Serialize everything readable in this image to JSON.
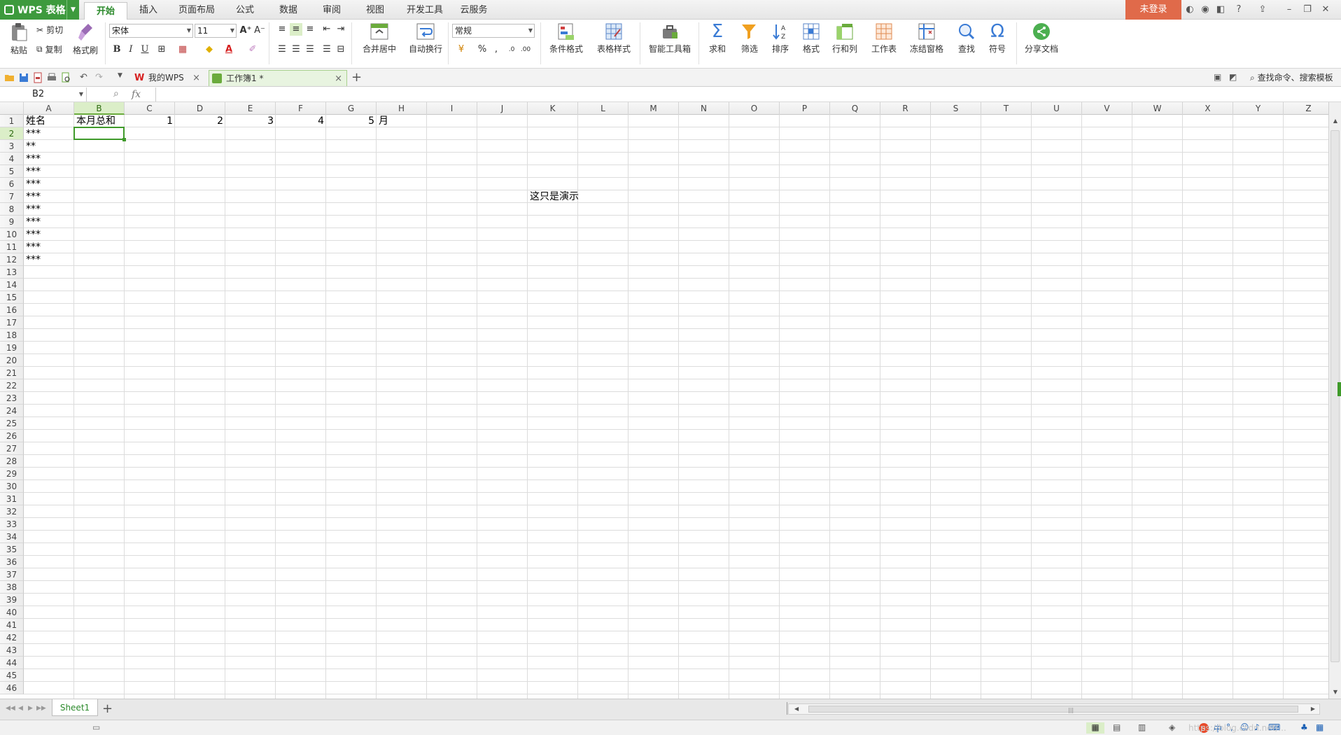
{
  "app": {
    "name": "WPS 表格",
    "login_label": "未登录"
  },
  "menu": {
    "tabs": [
      {
        "label": "开始",
        "active": true
      },
      {
        "label": "插入"
      },
      {
        "label": "页面布局"
      },
      {
        "label": "公式"
      },
      {
        "label": "数据"
      },
      {
        "label": "审阅"
      },
      {
        "label": "视图"
      },
      {
        "label": "开发工具"
      },
      {
        "label": "云服务"
      }
    ]
  },
  "ribbon": {
    "paste": "粘贴",
    "cut": "剪切",
    "copy": "复制",
    "format_painter": "格式刷",
    "font_name": "宋体",
    "font_size": "11",
    "merge_center": "合并居中",
    "wrap_text": "自动换行",
    "number_format": "常规",
    "percent": "%",
    "comma": ",",
    "conditional_format": "条件格式",
    "table_style": "表格样式",
    "smart_toolbox": "智能工具箱",
    "sum": "求和",
    "filter": "筛选",
    "sort": "排序",
    "format": "格式",
    "rows_cols": "行和列",
    "worksheet": "工作表",
    "freeze": "冻结窗格",
    "find": "查找",
    "symbol": "符号",
    "share": "分享文档",
    "bold": "B",
    "italic": "I",
    "underline": "U"
  },
  "doc_tabs": [
    {
      "label": "我的WPS",
      "active": false
    },
    {
      "label": "工作簿1 *",
      "active": true
    }
  ],
  "search_cmd": "查找命令、搜索模板",
  "formula_bar": {
    "name_box": "B2",
    "fx": "fx",
    "content": ""
  },
  "grid": {
    "columns": [
      "A",
      "B",
      "C",
      "D",
      "E",
      "F",
      "G",
      "H",
      "I",
      "J",
      "K",
      "L",
      "M",
      "N",
      "O",
      "P",
      "Q",
      "R",
      "S",
      "T",
      "U",
      "V",
      "W",
      "X",
      "Y",
      "Z"
    ],
    "rows": [
      "1",
      "2",
      "3",
      "4",
      "5",
      "6",
      "7",
      "8",
      "9",
      "10",
      "11",
      "12",
      "13",
      "14",
      "15",
      "16",
      "17",
      "18",
      "19",
      "20",
      "21",
      "22",
      "23",
      "24",
      "25",
      "26",
      "27",
      "28",
      "29",
      "30",
      "31",
      "32",
      "33",
      "34",
      "35",
      "36",
      "37",
      "38",
      "39",
      "40",
      "41",
      "42",
      "43",
      "44",
      "45",
      "46"
    ],
    "selected_cell": "B2",
    "cells": [
      {
        "ref": "A1",
        "text": "姓名"
      },
      {
        "ref": "B1",
        "text": "本月总和"
      },
      {
        "ref": "C1",
        "text": "1",
        "num": true
      },
      {
        "ref": "D1",
        "text": "2",
        "num": true
      },
      {
        "ref": "E1",
        "text": "3",
        "num": true
      },
      {
        "ref": "F1",
        "text": "4",
        "num": true
      },
      {
        "ref": "G1",
        "text": "5",
        "num": true
      },
      {
        "ref": "H1",
        "text": "月"
      },
      {
        "ref": "A2",
        "text": "***"
      },
      {
        "ref": "A3",
        "text": "**"
      },
      {
        "ref": "A4",
        "text": "***"
      },
      {
        "ref": "A5",
        "text": "***"
      },
      {
        "ref": "A6",
        "text": "***"
      },
      {
        "ref": "A7",
        "text": "***"
      },
      {
        "ref": "A8",
        "text": "***"
      },
      {
        "ref": "A9",
        "text": "***"
      },
      {
        "ref": "A10",
        "text": "***"
      },
      {
        "ref": "A11",
        "text": "***"
      },
      {
        "ref": "A12",
        "text": "***"
      },
      {
        "ref": "K7",
        "text": "这只是演示"
      }
    ]
  },
  "sheets": [
    {
      "label": "Sheet1",
      "active": true
    }
  ],
  "watermark": "https://blog.csdn.net/..."
}
